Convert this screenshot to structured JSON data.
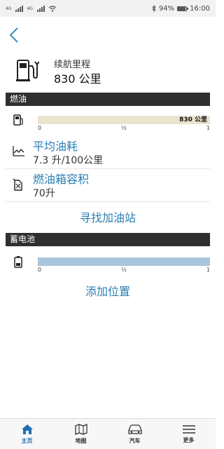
{
  "status_bar": {
    "network_1": "4G",
    "network_2": "4G",
    "battery": "94%",
    "battery_level": 0.94,
    "time": "16:00"
  },
  "range": {
    "label": "续航里程",
    "value": "830 公里"
  },
  "fuel": {
    "header": "燃油",
    "gauge": {
      "value_label": "830 公里",
      "fill_fraction": 1.0,
      "tick_min": "0",
      "tick_mid": "½",
      "tick_max": "1"
    },
    "avg_consumption": {
      "title": "平均油耗",
      "value": "7.3 升/100公里"
    },
    "tank_capacity": {
      "title": "燃油箱容积",
      "value": "70升"
    },
    "find_station_label": "寻找加油站"
  },
  "battery": {
    "header": "蓄电池",
    "gauge": {
      "fill_fraction": 1.0,
      "tick_min": "0",
      "tick_mid": "½",
      "tick_max": "1"
    },
    "add_location_label": "添加位置"
  },
  "nav": [
    {
      "label": "主页",
      "icon": "home-icon",
      "active": true
    },
    {
      "label": "地图",
      "icon": "map-icon",
      "active": false
    },
    {
      "label": "汽车",
      "icon": "car-icon",
      "active": false
    },
    {
      "label": "更多",
      "icon": "menu-icon",
      "active": false
    }
  ],
  "colors": {
    "accent": "#2a7fb3",
    "nav_active": "#1f6fb2",
    "section_header": "#2f2f2f",
    "fuel_gauge_fill": "#e9e4cc",
    "battery_gauge_fill": "#a9c5db"
  }
}
